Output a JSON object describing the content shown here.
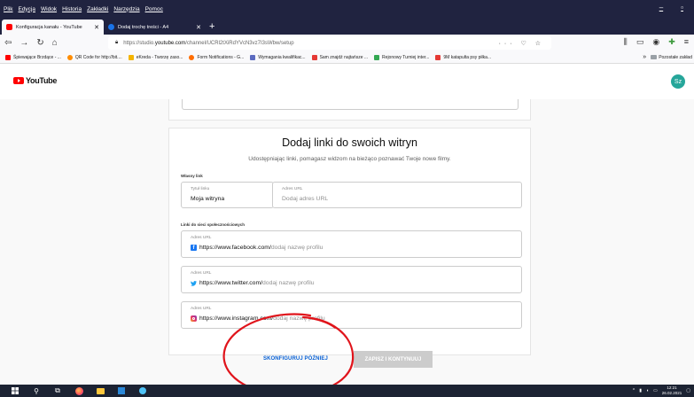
{
  "browser": {
    "menu": [
      "Plik",
      "Edycja",
      "Widok",
      "Historia",
      "Zakładki",
      "Narzędzia",
      "Pomoc"
    ],
    "tabs": [
      {
        "title": "Konfiguracja kanału - YouTube",
        "active": true,
        "favicon_color": "#ff0000"
      },
      {
        "title": "Dodaj trochę treści - A4",
        "active": false,
        "favicon_color": "#1a73e8"
      }
    ],
    "new_tab": "+",
    "url_prefix": "https://studio.",
    "url_domain": "youtube.com",
    "url_path": "/channel/UCRl2tXiRdYVcN3vz7I3sWbw/setup",
    "url_actions": "··· ♡ ☆",
    "bookmarks": [
      {
        "label": "Śpiewające Brzdące - ...",
        "color": "#ff0000"
      },
      {
        "label": "QR Code for http://bit....",
        "color": "#ff8c00"
      },
      {
        "label": "eKreda - Tworzę zaso...",
        "color": "#f4b400"
      },
      {
        "label": "Form Notifications - G...",
        "color": "#ff6d00"
      },
      {
        "label": "Wymagania kwalifikac...",
        "color": "#5c6bc0"
      },
      {
        "label": "Sam znajdź najtańsze ...",
        "color": "#e53935"
      },
      {
        "label": "Rejonowy Turniej inter...",
        "color": "#34a853"
      },
      {
        "label": "9M katapulta psy piłka...",
        "color": "#e53935"
      }
    ],
    "bookmarks_more": "»",
    "bookmarks_other": "Pozostałe zakład"
  },
  "youtube": {
    "logo_text": "YouTube",
    "avatar_initials": "Sz",
    "avatar_color": "#26a69a"
  },
  "card": {
    "title": "Dodaj linki do swoich witryn",
    "subtitle": "Udostępniając linki, pomagasz widzom na bieżąco poznawać Twoje nowe filmy.",
    "own_link_section": "Własny link",
    "link_title_label": "Tytuł linku",
    "link_title_value": "Moja witryna",
    "url_label": "Adres URL",
    "url_placeholder": "Dodaj adres URL",
    "social_section": "Linki do sieci społecznościowych",
    "social": [
      {
        "label": "Adres URL",
        "prefix": "https://www.facebook.com/",
        "placeholder": "dodaj nazwę profilu",
        "icon": "facebook-icon",
        "color": "#1877f2"
      },
      {
        "label": "Adres URL",
        "prefix": "https://www.twitter.com/",
        "placeholder": "dodaj nazwę profilu",
        "icon": "twitter-icon",
        "color": "#1da1f2"
      },
      {
        "label": "Adres URL",
        "prefix": "https://www.instagram.com/",
        "placeholder": "dodaj nazwę profilu",
        "icon": "instagram-icon",
        "color": "#c13584"
      }
    ]
  },
  "footer": {
    "later_label": "SKONFIGURUJ PÓŹNIEJ",
    "save_label": "ZAPISZ I KONTYNUUJ"
  },
  "taskbar": {
    "time": "12:21",
    "date": "26.02.2021"
  },
  "colors": {
    "accent": "#065fd4",
    "annotation": "#e0141b"
  }
}
